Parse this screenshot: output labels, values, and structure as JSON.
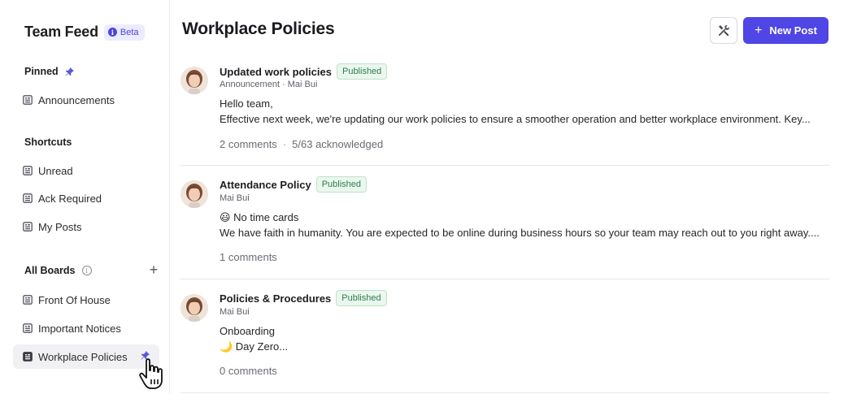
{
  "sidebar": {
    "title": "Team Feed",
    "beta_label": "Beta",
    "pinned_heading": "Pinned",
    "pinned_items": [
      {
        "label": "Announcements"
      }
    ],
    "shortcuts_heading": "Shortcuts",
    "shortcuts": [
      {
        "label": "Unread"
      },
      {
        "label": "Ack Required"
      },
      {
        "label": "My Posts"
      }
    ],
    "boards_heading": "All Boards",
    "boards": [
      {
        "label": "Front Of House"
      },
      {
        "label": "Important Notices"
      },
      {
        "label": "Workplace Policies"
      }
    ]
  },
  "main": {
    "title": "Workplace Policies",
    "new_post_label": "New Post",
    "posts": [
      {
        "title": "Updated work policies",
        "status": "Published",
        "meta": "Announcement · Mai Bui",
        "body": [
          "Hello team,",
          "Effective next week, we're updating our work policies to ensure a smoother operation and better workplace environment. Key..."
        ],
        "comments": "2 comments",
        "acknowledged": "5/63 acknowledged"
      },
      {
        "title": "Attendance Policy",
        "status": "Published",
        "meta": "Mai Bui",
        "body": [
          "😃 No time cards",
          "We have faith in humanity. You are expected to be online during business hours so your team may reach out to you right away...."
        ],
        "comments": "1 comments"
      },
      {
        "title": "Policies & Procedures",
        "status": "Published",
        "meta": "Mai Bui",
        "body": [
          "Onboarding",
          "🌙 Day Zero..."
        ],
        "comments": "0 comments"
      }
    ]
  },
  "colors": {
    "accent": "#4f46e5",
    "beta_bg": "#ecebff",
    "published_text": "#2e7d4f",
    "published_bg": "#eaf7ee",
    "active_item_bg": "#f1f1f3"
  },
  "icons": {
    "pin": "pin-icon",
    "board": "board-icon",
    "info": "info-icon",
    "add": "plus-icon",
    "tools": "tools-icon",
    "cursor": "hand-cursor-icon"
  }
}
